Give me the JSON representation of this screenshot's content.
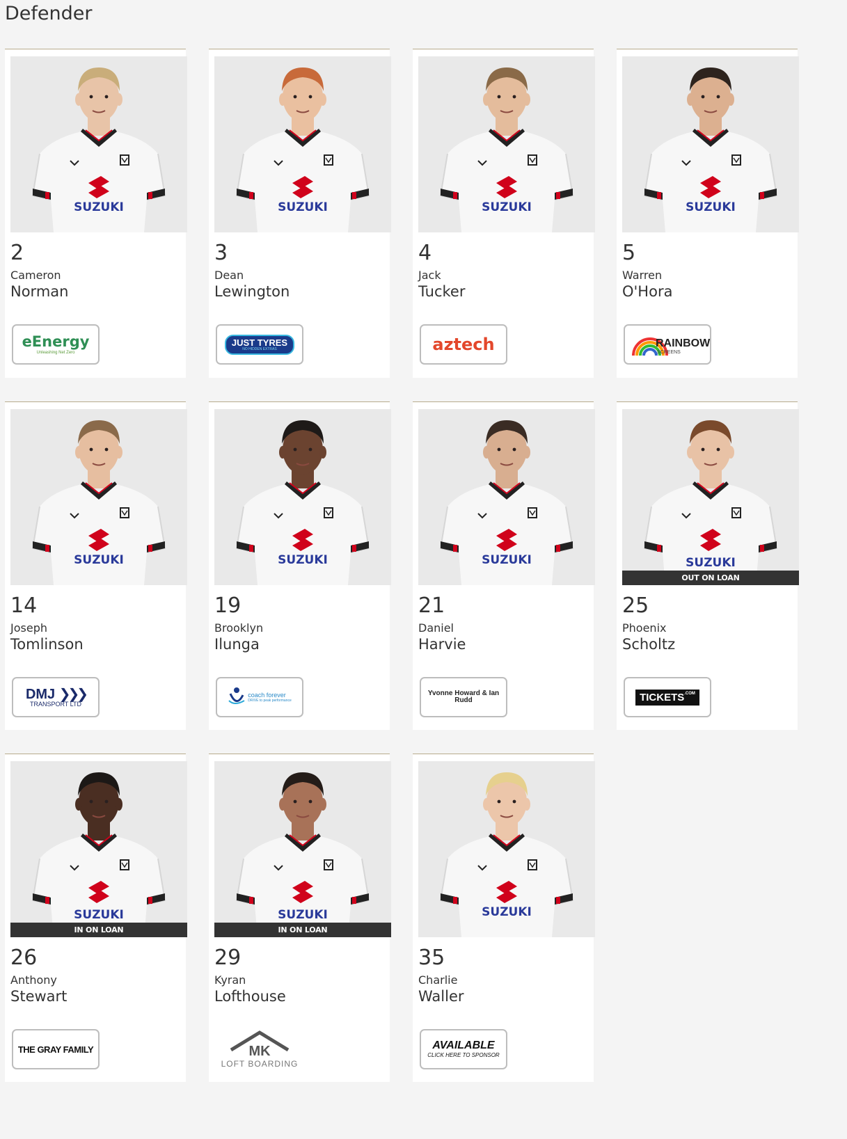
{
  "section": {
    "title": "Defender"
  },
  "players": [
    {
      "number": "2",
      "first": "Cameron",
      "last": "Norman",
      "loan": "",
      "sponsor": {
        "line1": "eEnergy",
        "line2": "Unleashing Net Zero",
        "style": "eenergy"
      }
    },
    {
      "number": "3",
      "first": "Dean",
      "last": "Lewington",
      "loan": "",
      "sponsor": {
        "line1": "JUST TYRES",
        "line2": "NO HIDDEN EXTRAS",
        "style": "justtyres"
      }
    },
    {
      "number": "4",
      "first": "Jack",
      "last": "Tucker",
      "loan": "",
      "sponsor": {
        "line1": "aztech",
        "line2": "",
        "style": "aztech"
      }
    },
    {
      "number": "5",
      "first": "Warren",
      "last": "O'Hora",
      "loan": "",
      "sponsor": {
        "line1": "RAINBOW",
        "line2": "SCREENS",
        "style": "rainbow"
      }
    },
    {
      "number": "14",
      "first": "Joseph",
      "last": "Tomlinson",
      "loan": "",
      "sponsor": {
        "line1": "DMJ",
        "line2": "TRANSPORT LTD",
        "style": "dmj"
      }
    },
    {
      "number": "19",
      "first": "Brooklyn",
      "last": "Ilunga",
      "loan": "",
      "sponsor": {
        "line1": "coach forever",
        "line2": "DRIVE to peak performance",
        "style": "coach"
      }
    },
    {
      "number": "21",
      "first": "Daniel",
      "last": "Harvie",
      "loan": "",
      "sponsor": {
        "line1": "Yvonne Howard & Ian Rudd",
        "line2": "",
        "style": "yvonne"
      }
    },
    {
      "number": "25",
      "first": "Phoenix",
      "last": "Scholtz",
      "loan": "OUT ON LOAN",
      "sponsor": {
        "line1": "TICKETS",
        "line2": ".COM",
        "style": "tickets"
      }
    },
    {
      "number": "26",
      "first": "Anthony",
      "last": "Stewart",
      "loan": "IN ON LOAN",
      "sponsor": {
        "line1": "THE GRAY FAMILY",
        "line2": "",
        "style": "gray"
      }
    },
    {
      "number": "29",
      "first": "Kyran",
      "last": "Lofthouse",
      "loan": "IN ON LOAN",
      "sponsor": {
        "line1": "MK",
        "line2": "LOFT BOARDING",
        "style": "mkloft"
      }
    },
    {
      "number": "35",
      "first": "Charlie",
      "last": "Waller",
      "loan": "",
      "sponsor": {
        "line1": "AVAILABLE",
        "line2": "CLICK HERE TO SPONSOR",
        "style": "available"
      }
    }
  ],
  "kit": {
    "shirt_sponsor": "SUZUKI",
    "brand_color": "#d0021b",
    "wordmark_color": "#2a3a9a"
  },
  "colors": {
    "background": "#f4f4f4",
    "card": "#ffffff",
    "card_rule": "#b7ab8c",
    "badge": "#333333"
  }
}
